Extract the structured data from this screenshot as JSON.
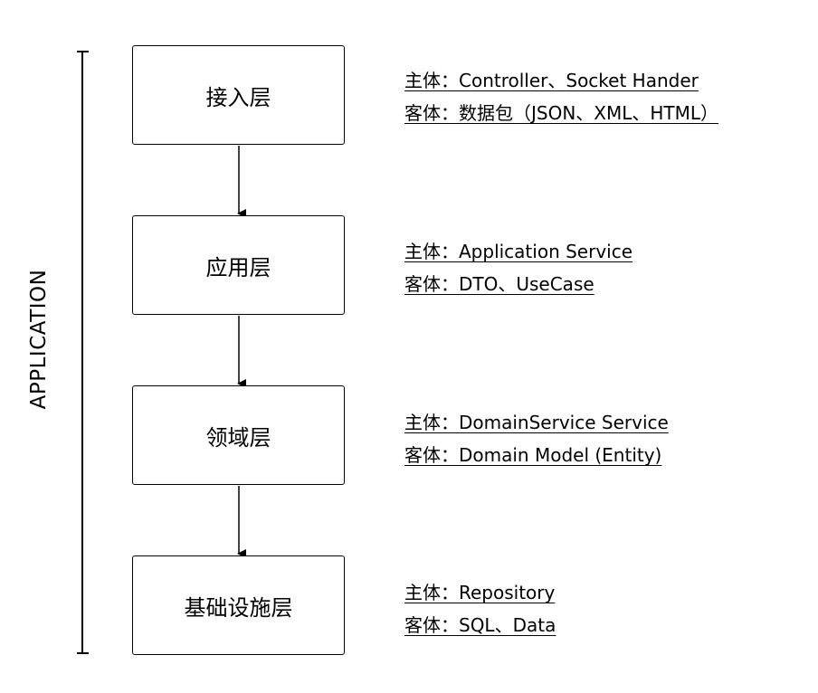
{
  "side_label": "APPLICATION",
  "layers": [
    {
      "name": "接入层",
      "subject": "主体：Controller、Socket Hander",
      "object": "客体：数据包（JSON、XML、HTML）"
    },
    {
      "name": "应用层",
      "subject": "主体：Application Service",
      "object": "客体：DTO、UseCase"
    },
    {
      "name": "领域层",
      "subject": "主体：DomainService Service",
      "object": "客体：Domain Model (Entity)"
    },
    {
      "name": "基础设施层",
      "subject": "主体：Repository",
      "object": "客体：SQL、Data"
    }
  ]
}
